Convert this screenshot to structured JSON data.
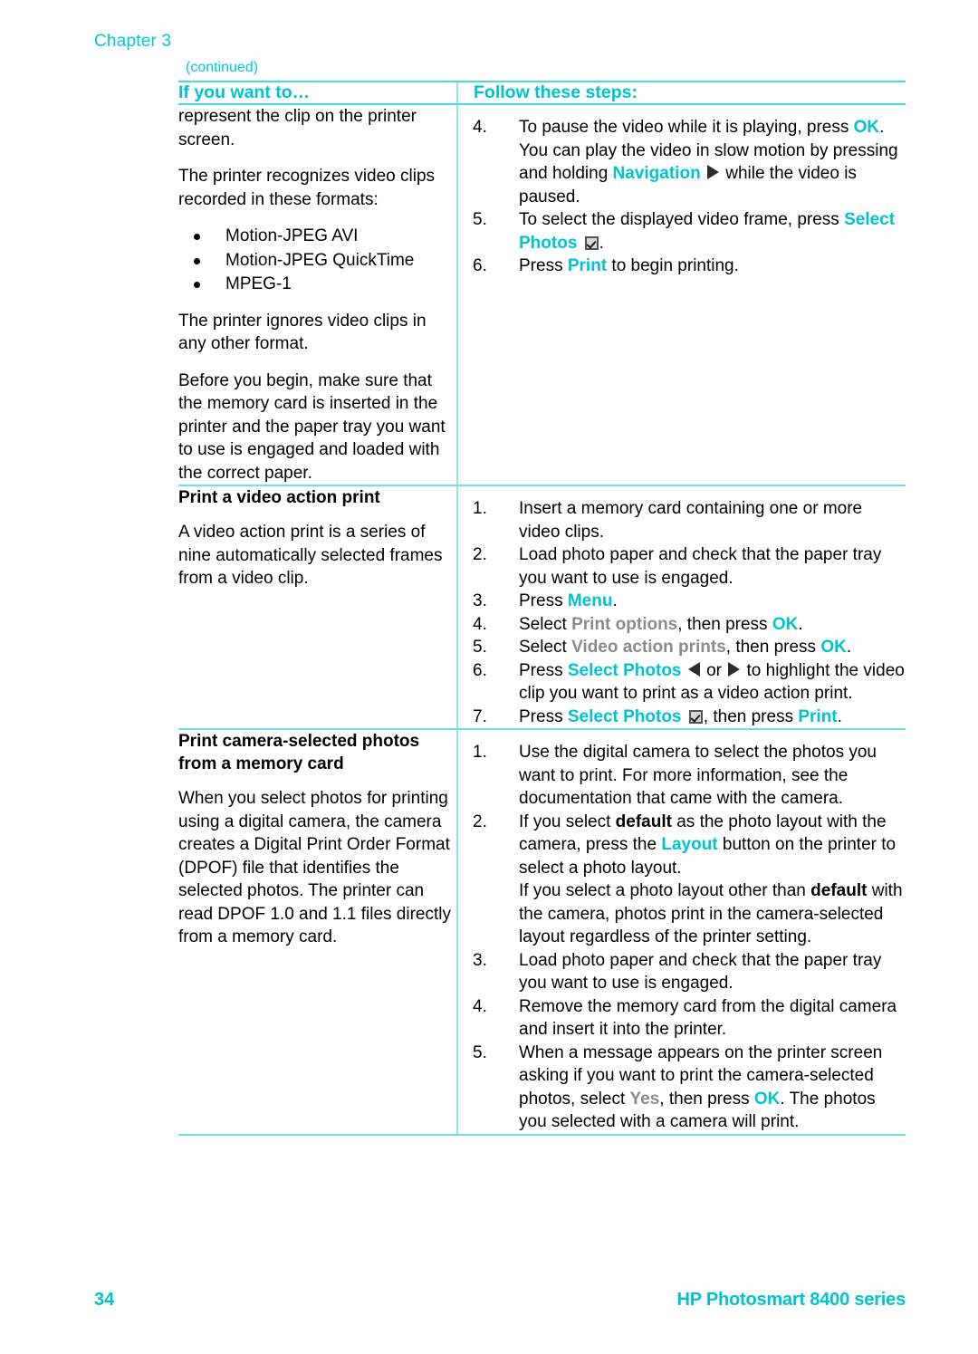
{
  "header": {
    "chapter": "Chapter 3",
    "continued": "(continued)"
  },
  "table": {
    "columns": {
      "left_header": "If you want to…",
      "right_header": "Follow these steps:"
    },
    "rows": [
      {
        "left": {
          "paragraphs": [
            "represent the clip on the printer screen.",
            "The printer recognizes video clips recorded in these formats:"
          ],
          "bullets": [
            "Motion-JPEG AVI",
            "Motion-JPEG QuickTime",
            "MPEG-1"
          ],
          "paragraphs_after": [
            "The printer ignores video clips in any other format.",
            "Before you begin, make sure that the memory card is inserted in the printer and the paper tray you want to use is engaged and loaded with the correct paper."
          ]
        },
        "steps": [
          {
            "num": "4.",
            "parts": [
              {
                "t": "To pause the video while it is playing, press ",
                "s": "plain"
              },
              {
                "t": "OK",
                "s": "ui"
              },
              {
                "t": ". You can play the video in slow motion by pressing and holding ",
                "s": "plain"
              },
              {
                "t": "Navigation",
                "s": "ui"
              },
              {
                "t": " ",
                "s": "plain"
              },
              {
                "t": "",
                "s": "icon-right"
              },
              {
                "t": " while the video is paused.",
                "s": "plain"
              }
            ]
          },
          {
            "num": "5.",
            "parts": [
              {
                "t": "To select the displayed video frame, press ",
                "s": "plain"
              },
              {
                "t": "Select Photos",
                "s": "ui"
              },
              {
                "t": " ",
                "s": "plain"
              },
              {
                "t": "",
                "s": "icon-check"
              },
              {
                "t": ".",
                "s": "plain"
              }
            ]
          },
          {
            "num": "6.",
            "parts": [
              {
                "t": "Press ",
                "s": "plain"
              },
              {
                "t": "Print",
                "s": "ui"
              },
              {
                "t": " to begin printing.",
                "s": "plain"
              }
            ]
          }
        ]
      },
      {
        "left": {
          "subhead": "Print a video action print",
          "paragraphs": [
            "A video action print is a series of nine automatically selected frames from a video clip."
          ]
        },
        "steps": [
          {
            "num": "1.",
            "parts": [
              {
                "t": "Insert a memory card containing one or more video clips.",
                "s": "plain"
              }
            ]
          },
          {
            "num": "2.",
            "parts": [
              {
                "t": "Load photo paper and check that the paper tray you want to use is engaged.",
                "s": "plain"
              }
            ]
          },
          {
            "num": "3.",
            "parts": [
              {
                "t": "Press ",
                "s": "plain"
              },
              {
                "t": "Menu",
                "s": "ui"
              },
              {
                "t": ".",
                "s": "plain"
              }
            ]
          },
          {
            "num": "4.",
            "parts": [
              {
                "t": "Select ",
                "s": "plain"
              },
              {
                "t": "Print options",
                "s": "uigray"
              },
              {
                "t": ", then press ",
                "s": "plain"
              },
              {
                "t": "OK",
                "s": "ui"
              },
              {
                "t": ".",
                "s": "plain"
              }
            ]
          },
          {
            "num": "5.",
            "parts": [
              {
                "t": "Select ",
                "s": "plain"
              },
              {
                "t": "Video action prints",
                "s": "uigray"
              },
              {
                "t": ", then press ",
                "s": "plain"
              },
              {
                "t": "OK",
                "s": "ui"
              },
              {
                "t": ".",
                "s": "plain"
              }
            ]
          },
          {
            "num": "6.",
            "parts": [
              {
                "t": "Press ",
                "s": "plain"
              },
              {
                "t": "Select Photos",
                "s": "ui"
              },
              {
                "t": " ",
                "s": "plain"
              },
              {
                "t": "",
                "s": "icon-left"
              },
              {
                "t": " or ",
                "s": "plain"
              },
              {
                "t": "",
                "s": "icon-right"
              },
              {
                "t": " to highlight the video clip you want to print as a video action print.",
                "s": "plain"
              }
            ]
          },
          {
            "num": "7.",
            "parts": [
              {
                "t": "Press ",
                "s": "plain"
              },
              {
                "t": "Select Photos",
                "s": "ui"
              },
              {
                "t": " ",
                "s": "plain"
              },
              {
                "t": "",
                "s": "icon-check"
              },
              {
                "t": ", then press ",
                "s": "plain"
              },
              {
                "t": "Print",
                "s": "ui"
              },
              {
                "t": ".",
                "s": "plain"
              }
            ]
          }
        ]
      },
      {
        "left": {
          "subhead": "Print camera-selected photos from a memory card",
          "paragraphs": [
            "When you select photos for printing using a digital camera, the camera creates a Digital Print Order Format (DPOF) file that identifies the selected photos. The printer can read DPOF 1.0 and 1.1 files directly from a memory card."
          ]
        },
        "steps": [
          {
            "num": "1.",
            "parts": [
              {
                "t": "Use the digital camera to select the photos you want to print. For more information, see the documentation that came with the camera.",
                "s": "plain"
              }
            ]
          },
          {
            "num": "2.",
            "parts": [
              {
                "t": "If you select ",
                "s": "plain"
              },
              {
                "t": "default",
                "s": "bold"
              },
              {
                "t": " as the photo layout with the camera, press the ",
                "s": "plain"
              },
              {
                "t": "Layout",
                "s": "ui"
              },
              {
                "t": " button on the printer to select a photo layout.",
                "s": "plain"
              },
              {
                "t": "BREAK",
                "s": "break"
              },
              {
                "t": "If you select a photo layout other than ",
                "s": "plain"
              },
              {
                "t": "default",
                "s": "bold"
              },
              {
                "t": " with the camera, photos print in the camera-selected layout regardless of the printer setting.",
                "s": "plain"
              }
            ]
          },
          {
            "num": "3.",
            "parts": [
              {
                "t": "Load photo paper and check that the paper tray you want to use is engaged.",
                "s": "plain"
              }
            ]
          },
          {
            "num": "4.",
            "parts": [
              {
                "t": "Remove the memory card from the digital camera and insert it into the printer.",
                "s": "plain"
              }
            ]
          },
          {
            "num": "5.",
            "parts": [
              {
                "t": "When a message appears on the printer screen asking if you want to print the camera-selected photos, select ",
                "s": "plain"
              },
              {
                "t": "Yes",
                "s": "uigray"
              },
              {
                "t": ", then press ",
                "s": "plain"
              },
              {
                "t": "OK",
                "s": "ui"
              },
              {
                "t": ". The photos you selected with a camera will print.",
                "s": "plain"
              }
            ]
          }
        ]
      }
    ]
  },
  "footer": {
    "page_number": "34",
    "product": "HP Photosmart 8400 series"
  },
  "colors": {
    "accent_teal": "#00c3d1",
    "rule_teal": "#6fdfe8",
    "ui_gray": "#8b8b8b"
  },
  "icons": {
    "nav_right": "triangle-right-icon",
    "nav_left": "triangle-left-icon",
    "select_photos": "checkbox-checked-icon"
  }
}
